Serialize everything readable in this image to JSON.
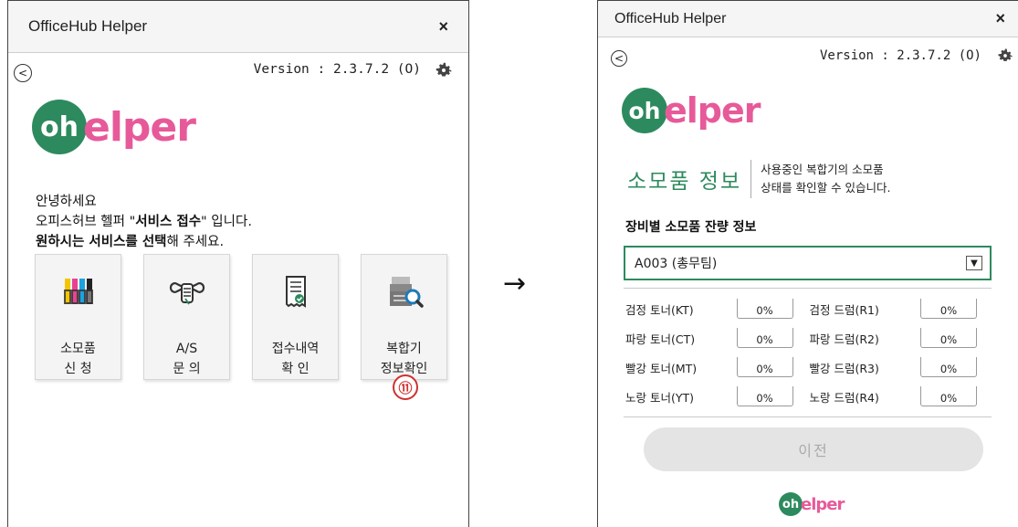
{
  "window_title": "OfficeHub Helper",
  "close_glyph": "×",
  "back_glyph": "<",
  "version": "Version : 2.3.7.2 (O)",
  "logo_text": "helper",
  "arrow": "→",
  "left": {
    "greeting_line1": "안녕하세요",
    "greeting_line2_pre": "오피스허브 헬퍼 \"",
    "greeting_line2_bold": "서비스 접수",
    "greeting_line2_post": "\" 입니다.",
    "greeting_line3_bold": "원하시는 서비스를 선택",
    "greeting_line3_post": "해 주세요.",
    "tiles": [
      {
        "line1": "소모품",
        "line2": "신 청",
        "icon": "toner-cartridges-icon"
      },
      {
        "line1": "A/S",
        "line2": "문 의",
        "icon": "wrench-icon"
      },
      {
        "line1": "접수내역",
        "line2": "확 인",
        "icon": "receipt-icon"
      },
      {
        "line1": "복합기",
        "line2": "정보확인",
        "icon": "printer-search-icon"
      }
    ],
    "step_badge": "⑪"
  },
  "right": {
    "section_title": "소모품 정보",
    "section_desc1": "사용중인 복합기의 소모품",
    "section_desc2": "상태를 확인할 수 있습니다.",
    "device_heading": "장비별 소모품 잔량 정보",
    "selected_device": "A003 (총무팀)",
    "consumables": [
      {
        "name": "검정 토너(KT)",
        "value": "0%"
      },
      {
        "name": "검정 드럼(R1)",
        "value": "0%"
      },
      {
        "name": "파랑 토너(CT)",
        "value": "0%"
      },
      {
        "name": "파랑 드럼(R2)",
        "value": "0%"
      },
      {
        "name": "빨강 토너(MT)",
        "value": "0%"
      },
      {
        "name": "빨강 드럼(R3)",
        "value": "0%"
      },
      {
        "name": "노랑 토너(YT)",
        "value": "0%"
      },
      {
        "name": "노랑 드럼(R4)",
        "value": "0%"
      }
    ],
    "prev_button": "이전"
  },
  "colors": {
    "brand_green": "#2d8a5e",
    "brand_pink": "#e75a9a",
    "badge_red": "#d03030"
  }
}
